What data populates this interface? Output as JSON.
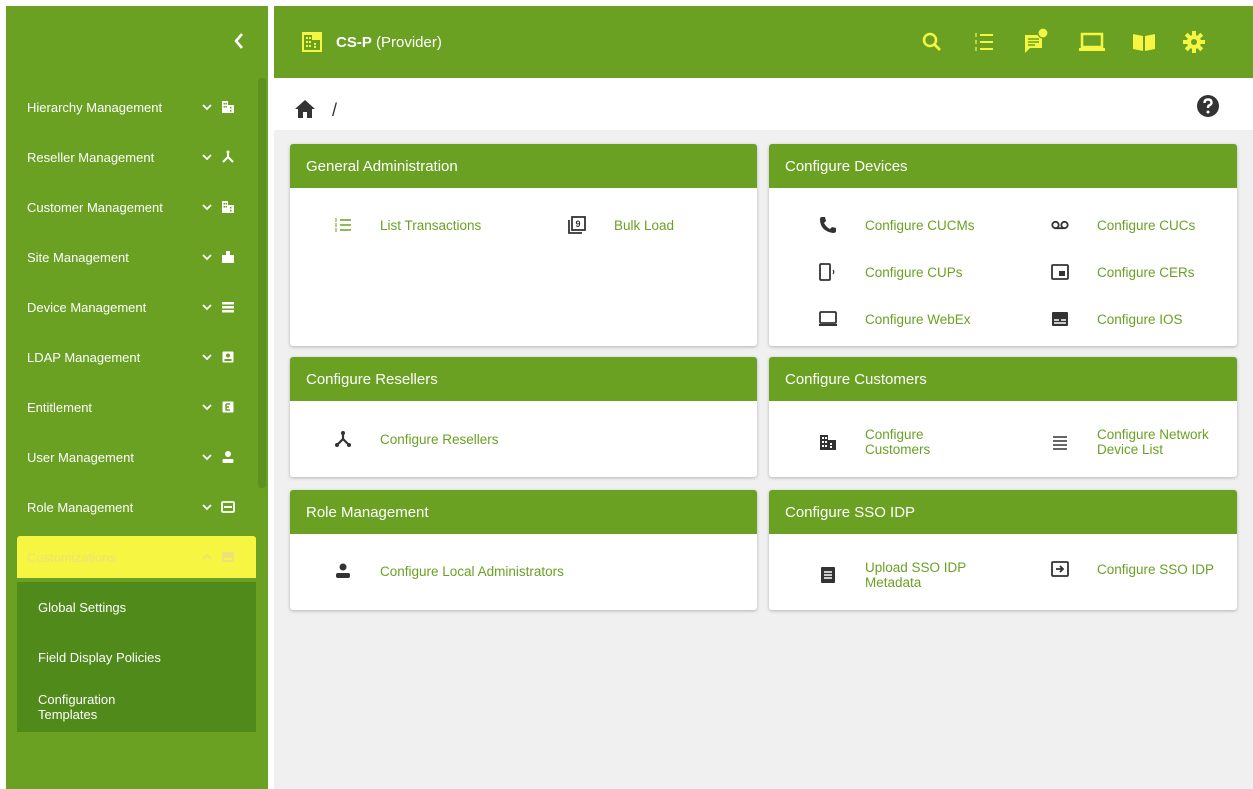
{
  "header": {
    "org_name": "CS-P",
    "org_type": " (Provider)",
    "icons": [
      "search-icon",
      "transactions-icon",
      "notifications-icon",
      "laptop-icon",
      "book-icon",
      "gear-icon"
    ]
  },
  "sidebar": {
    "items": [
      {
        "label": "Hierarchy Management",
        "icon": "building-icon"
      },
      {
        "label": "Reseller Management",
        "icon": "reseller-icon"
      },
      {
        "label": "Customer Management",
        "icon": "building-icon"
      },
      {
        "label": "Site Management",
        "icon": "site-icon"
      },
      {
        "label": "Device Management",
        "icon": "device-list-icon"
      },
      {
        "label": "LDAP Management",
        "icon": "ldap-icon"
      },
      {
        "label": "Entitlement",
        "icon": "entitlement-icon"
      },
      {
        "label": "User Management",
        "icon": "user-icon"
      },
      {
        "label": "Role Management",
        "icon": "role-icon"
      }
    ],
    "active_item": {
      "label": "Customizations",
      "icon": "customizations-icon"
    },
    "sub_items": [
      "Global Settings",
      "Field Display Policies",
      "Configuration Templates"
    ]
  },
  "breadcrumb": {
    "separator": "/"
  },
  "cards": {
    "general_admin": {
      "title": "General Administration",
      "links": [
        {
          "label": "List Transactions",
          "icon": "list-icon"
        },
        {
          "label": "Bulk Load",
          "icon": "bulk-load-icon"
        }
      ]
    },
    "configure_devices": {
      "title": "Configure Devices",
      "links": [
        {
          "label": "Configure CUCMs",
          "icon": "phone-icon"
        },
        {
          "label": "Configure CUCs",
          "icon": "voicemail-icon"
        },
        {
          "label": "Configure CUPs",
          "icon": "mobile-icon"
        },
        {
          "label": "Configure CERs",
          "icon": "cer-icon"
        },
        {
          "label": "Configure WebEx",
          "icon": "laptop-icon"
        },
        {
          "label": "Configure IOS",
          "icon": "ios-icon"
        }
      ]
    },
    "configure_resellers": {
      "title": "Configure Resellers",
      "links": [
        {
          "label": "Configure Resellers",
          "icon": "reseller-icon"
        }
      ]
    },
    "configure_customers": {
      "title": "Configure Customers",
      "links": [
        {
          "label": "Configure Customers",
          "icon": "building-icon"
        },
        {
          "label": "Configure Network Device List",
          "icon": "list-lines-icon"
        }
      ]
    },
    "role_management": {
      "title": "Role Management",
      "links": [
        {
          "label": "Configure Local Administrators",
          "icon": "user-icon"
        }
      ]
    },
    "configure_sso": {
      "title": "Configure SSO IDP",
      "links": [
        {
          "label": "Upload SSO IDP Metadata",
          "icon": "document-icon"
        },
        {
          "label": "Configure SSO IDP",
          "icon": "login-icon"
        }
      ]
    }
  },
  "colors": {
    "brand_green": "#6aa123",
    "dark_green": "#4f8a1a",
    "highlight_yellow": "#f5f542",
    "notification_badge": "#f5f542"
  }
}
